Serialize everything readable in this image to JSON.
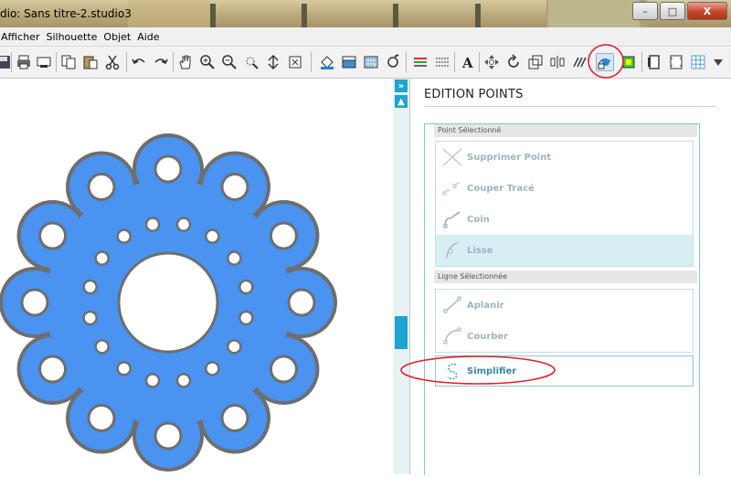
{
  "window": {
    "title": "dio: Sans titre-2.studio3",
    "buttons": {
      "minimize": "–",
      "maximize": "□",
      "close": "X"
    }
  },
  "menu": [
    "Afficher",
    "Silhouette",
    "Objet",
    "Aide"
  ],
  "toolbar": {
    "icons": [
      "save-icon",
      "print-icon",
      "cut-send-icon",
      "copy-icon",
      "paste-icon",
      "scissors-icon",
      "undo-icon",
      "redo-icon",
      "pan-hand-icon",
      "zoom-in-icon",
      "zoom-out-icon",
      "zoom-select-icon",
      "fit-page-icon",
      "zoom-fit-icon",
      "fill-color-icon",
      "gradient-icon",
      "pattern-icon",
      "line-color-icon",
      "line-style-icon",
      "lines-icon",
      "text-icon",
      "move-icon",
      "rotate-icon",
      "scale-icon",
      "align-icon",
      "replicate-icon",
      "point-edit-icon",
      "colour-icon",
      "page-setup-icon",
      "cut-settings-icon",
      "grid-icon",
      "more-icon"
    ]
  },
  "colors": {
    "shape_fill": "#4a93f0",
    "shape_border": "#6e6e6e",
    "accent": "#1fa3d2",
    "annotation": "#e0202a"
  },
  "panel": {
    "title": "EDITION POINTS",
    "point_section": {
      "header": "Point Sélectionné",
      "buttons": [
        {
          "label": "Supprimer Point",
          "icon": "delete-point-icon"
        },
        {
          "label": "Couper Tracé",
          "icon": "cut-path-icon"
        },
        {
          "label": "Coin",
          "icon": "corner-icon"
        },
        {
          "label": "Lisse",
          "icon": "smooth-icon"
        }
      ]
    },
    "line_section": {
      "header": "Ligne Sélectionnée",
      "buttons": [
        {
          "label": "Aplanir",
          "icon": "flatten-icon"
        },
        {
          "label": "Courber",
          "icon": "curve-icon"
        }
      ]
    },
    "simplify_label": "Simplifier"
  }
}
